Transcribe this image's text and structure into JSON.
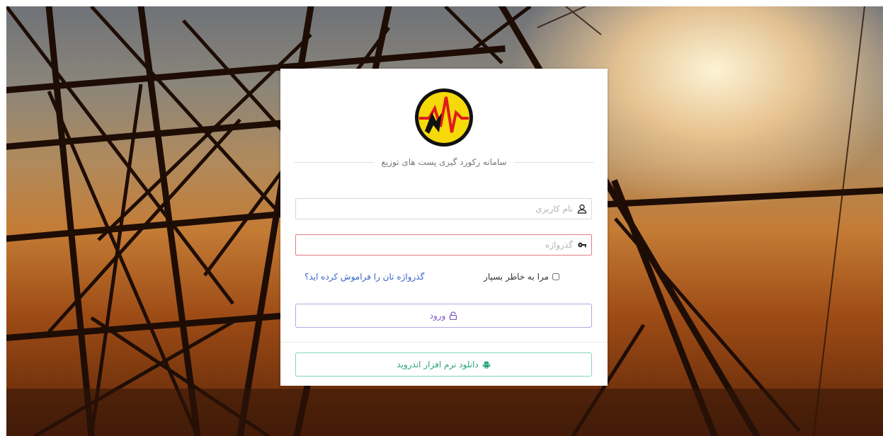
{
  "login": {
    "system_title": "سامانه رکورد گیری پست های توزیع",
    "username_placeholder": "نام کاربری",
    "password_placeholder": "گذرواژه",
    "remember_label": "مرا به خاطر بسپار",
    "forgot_link": "گذرواژه تان را فراموش کرده اید؟",
    "login_button": "ورود",
    "android_button": "دانلود نرم افزار اندروید"
  },
  "icons": {
    "logo": "power-company-logo",
    "username": "user-icon",
    "password": "key-icon",
    "login": "lock-icon",
    "android": "android-icon"
  },
  "colors": {
    "password_border": "#e17b86",
    "login_accent": "#7b5bc8",
    "android_accent": "#2aa37b",
    "link": "#3a63c8",
    "logo_yellow": "#f5d90a",
    "logo_red": "#e01b1b"
  }
}
